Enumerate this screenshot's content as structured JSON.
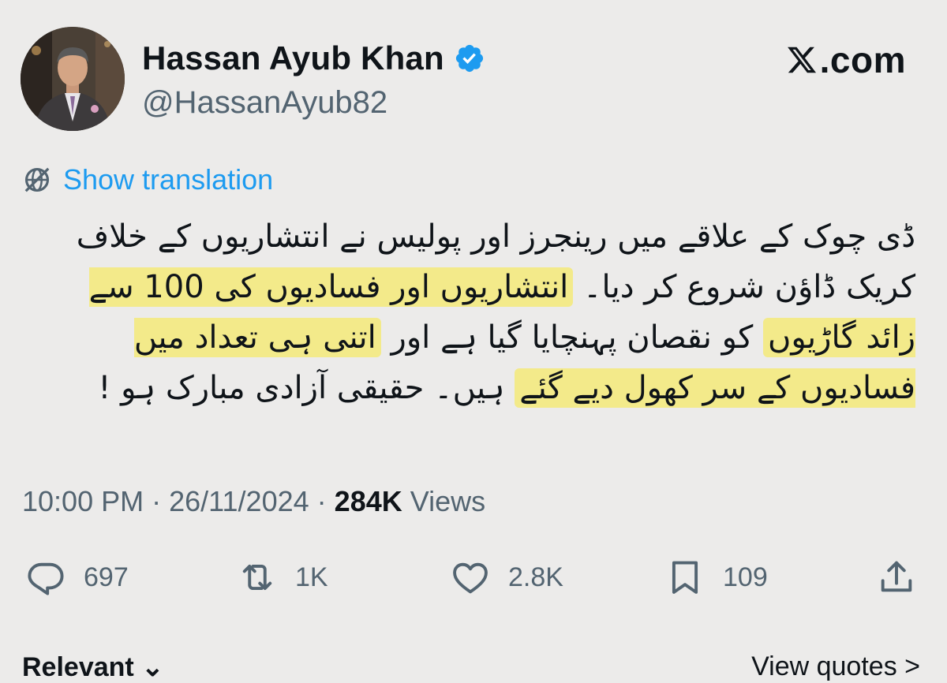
{
  "author": {
    "display_name": "Hassan Ayub Khan",
    "handle": "@HassanAyub82",
    "verified": true
  },
  "brand": {
    "domain": ".com",
    "accent_color": "#1d9bf0",
    "highlight_color": "#f3ea8a"
  },
  "translation": {
    "label": "Show translation",
    "icon": "globe-icon"
  },
  "tweet": {
    "part1": "ڈی چوک کے علاقے میں رینجرز اور پولیس نے انتشاریوں کے خلاف کریک ڈاؤن شروع کر دیا۔ ",
    "highlight1": "انتشاریوں اور فسادیوں کی 100 سے زائد گاڑیوں",
    "part2": " کو نقصان پہنچایا گیا ہے اور ",
    "highlight2": "اتنی ہی تعداد میں فسادیوں کے سر کھول دیے گئے",
    "part3": " ہیں۔ حقیقی آزادی مبارک ہو !"
  },
  "meta": {
    "time": "10:00 PM",
    "separator": "·",
    "date": "26/11/2024",
    "views_count": "284K",
    "views_label": "Views"
  },
  "actions": {
    "replies": {
      "icon": "reply-icon",
      "count": "697"
    },
    "reposts": {
      "icon": "repost-icon",
      "count": "1K"
    },
    "likes": {
      "icon": "heart-icon",
      "count": "2.8K"
    },
    "bookmarks": {
      "icon": "bookmark-icon",
      "count": "109"
    },
    "share": {
      "icon": "share-icon"
    }
  },
  "footer": {
    "sort_label": "Relevant ⌄",
    "view_quotes": "View quotes >"
  }
}
